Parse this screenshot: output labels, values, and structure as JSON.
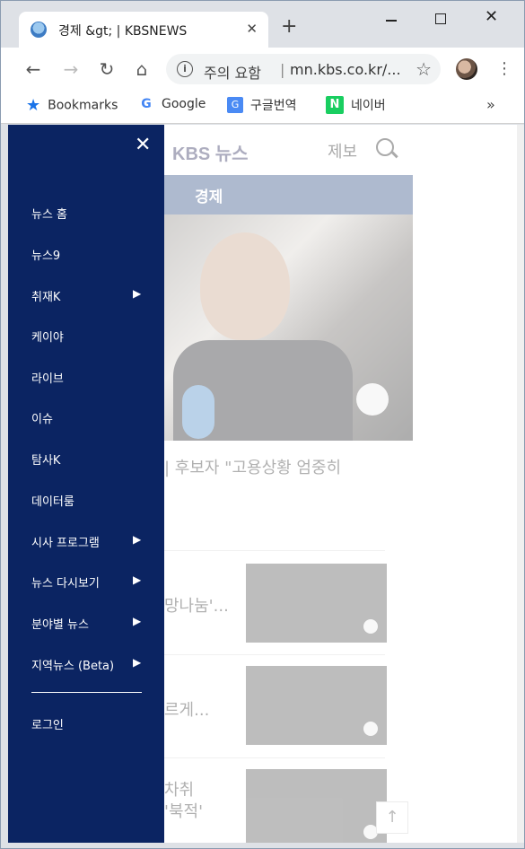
{
  "browser": {
    "tab_title": "경제 &gt; | KBSNEWS",
    "tab_close": "✕",
    "new_tab": "+",
    "window_close": "✕",
    "address_warning": "주의 요함",
    "address_separator": "|",
    "url": "mn.kbs.co.kr/...",
    "back": "←",
    "forward": "→",
    "reload": "↻",
    "home": "⌂",
    "star": "☆",
    "menu": "⋮",
    "info": "i"
  },
  "bookmarks": {
    "items": [
      {
        "label": "Bookmarks",
        "icon": "bookmark-star-icon"
      },
      {
        "label": "Google",
        "icon": "google-icon"
      },
      {
        "label": "구글번역",
        "icon": "google-translate-icon"
      },
      {
        "label": "네이버",
        "icon": "naver-icon"
      }
    ],
    "more": "»",
    "translate_glyph": "G",
    "naver_glyph": "N",
    "google_glyph": "G",
    "star_glyph": "★"
  },
  "page": {
    "logo": "KBS 뉴스",
    "report": "제보",
    "section": "경제",
    "headline": "| 후보자 \"고용상황 엄중히",
    "list_items": [
      {
        "text": "망나눔'..."
      },
      {
        "text": "르게..."
      },
      {
        "text": "차취"
      },
      {
        "text": "'북적'"
      }
    ],
    "to_top": "↑"
  },
  "drawer": {
    "close": "✕",
    "items": [
      {
        "label": "뉴스 홈",
        "has_submenu": false
      },
      {
        "label": "뉴스9",
        "has_submenu": false
      },
      {
        "label": "취재K",
        "has_submenu": true
      },
      {
        "label": "케이야",
        "has_submenu": false
      },
      {
        "label": "라이브",
        "has_submenu": false
      },
      {
        "label": "이슈",
        "has_submenu": false
      },
      {
        "label": "탐사K",
        "has_submenu": false
      },
      {
        "label": "데이터룸",
        "has_submenu": false
      },
      {
        "label": "시사 프로그램",
        "has_submenu": true
      },
      {
        "label": "뉴스 다시보기",
        "has_submenu": true
      },
      {
        "label": "분야별 뉴스",
        "has_submenu": true
      },
      {
        "label": "지역뉴스 (Beta)",
        "has_submenu": true
      }
    ],
    "arrow": "▶",
    "login": "로그인"
  },
  "colors": {
    "drawer_bg": "#0b2462",
    "section_bar": "#2d4d83"
  }
}
